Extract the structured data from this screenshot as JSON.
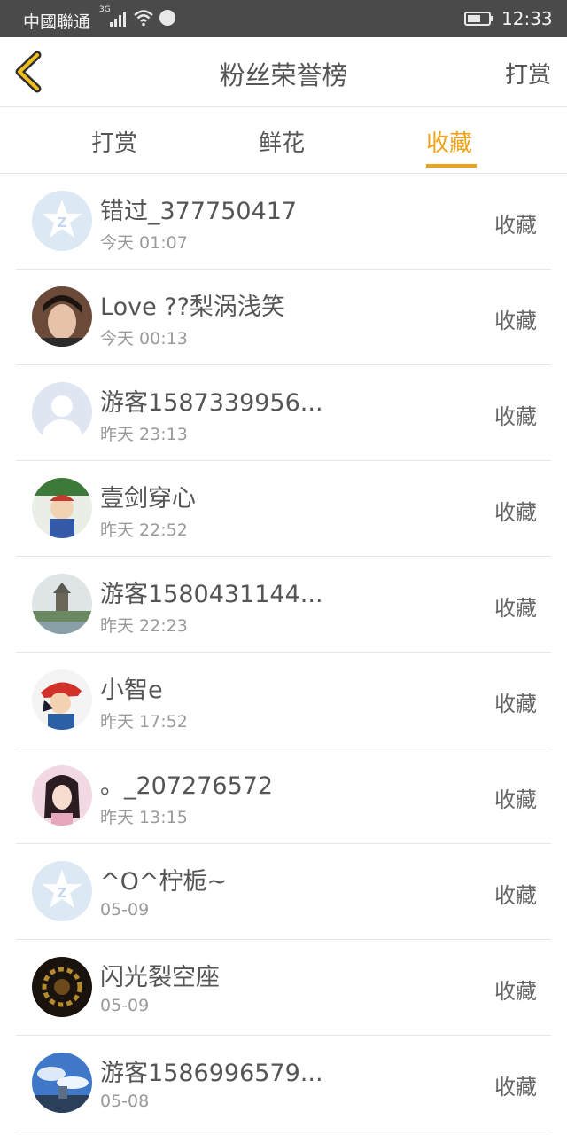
{
  "status_bar": {
    "carrier": "中國聯通",
    "network": "3G",
    "time": "12:33"
  },
  "header": {
    "title": "粉丝荣誉榜",
    "action": "打赏"
  },
  "tabs": [
    "打赏",
    "鲜花",
    "收藏"
  ],
  "active_tab": 2,
  "accent_color": "#f0a316",
  "rows": [
    {
      "name": "错过_377750417",
      "time": "今天 01:07",
      "action": "收藏",
      "avatar": "qzone-default-avatar"
    },
    {
      "name": "Love ??梨涡浅笑",
      "time": "今天 00:13",
      "action": "收藏",
      "avatar": "photo-avatar"
    },
    {
      "name": "游客1587339956...",
      "time": "昨天 23:13",
      "action": "收藏",
      "avatar": "guest-silhouette-avatar"
    },
    {
      "name": "壹剑穿心",
      "time": "昨天 22:52",
      "action": "收藏",
      "avatar": "cartoon-avatar"
    },
    {
      "name": "游客1580431144...",
      "time": "昨天 22:23",
      "action": "收藏",
      "avatar": "landscape-avatar"
    },
    {
      "name": "小智e",
      "time": "昨天 17:52",
      "action": "收藏",
      "avatar": "cartoon-avatar"
    },
    {
      "name": "。_207276572",
      "time": "昨天 13:15",
      "action": "收藏",
      "avatar": "photo-avatar"
    },
    {
      "name": "^O^柠栀~",
      "time": "05-09",
      "action": "收藏",
      "avatar": "qzone-default-avatar"
    },
    {
      "name": "闪光裂空座",
      "time": "05-09",
      "action": "收藏",
      "avatar": "dark-pattern-avatar"
    },
    {
      "name": "游客1586996579...",
      "time": "05-08",
      "action": "收藏",
      "avatar": "sky-avatar"
    }
  ]
}
